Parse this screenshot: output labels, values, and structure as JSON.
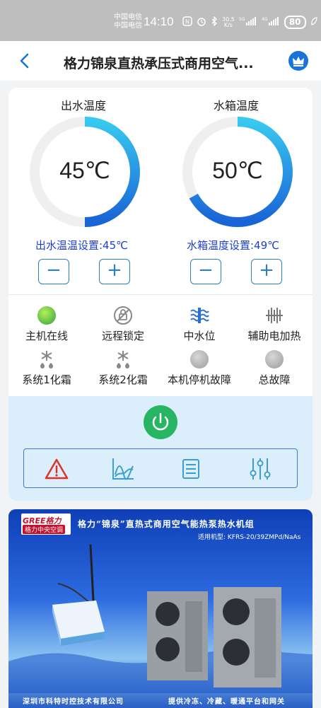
{
  "status_bar": {
    "carrier_1": "中国电信",
    "carrier_2": "中国电信",
    "time": "14:10",
    "net_speed": "30.5",
    "net_unit": "K/s",
    "battery": "80"
  },
  "header": {
    "title": "格力锦泉直热承压式商用空气..."
  },
  "gauges": [
    {
      "label": "出水温度",
      "value": "45℃",
      "fill_fraction": 0.5,
      "setpoint": "出水温温设置:45℃"
    },
    {
      "label": "水箱温度",
      "value": "50℃",
      "fill_fraction": 0.67,
      "setpoint": "水箱温度设置:49℃"
    }
  ],
  "stepper": {
    "minus": "−",
    "plus": "+"
  },
  "status_items": [
    {
      "label": "主机在线",
      "icon": "online-indicator-icon"
    },
    {
      "label": "远程锁定",
      "icon": "remote-lock-icon"
    },
    {
      "label": "中水位",
      "icon": "water-level-icon"
    },
    {
      "label": "辅助电加热",
      "icon": "electric-heat-icon"
    },
    {
      "label": "系统1化霜",
      "icon": "defrost-icon"
    },
    {
      "label": "系统2化霜",
      "icon": "defrost-icon"
    },
    {
      "label": "本机停机故障",
      "icon": "fault-dot-icon"
    },
    {
      "label": "总故障",
      "icon": "fault-dot-icon"
    }
  ],
  "toolbar": [
    "warning-icon",
    "chart-icon",
    "list-icon",
    "settings-sliders-icon"
  ],
  "banner": {
    "logo_top": "GREE格力",
    "logo_sub": "格力中央空调",
    "title": "格力“锦泉”直热式商用空气能热泵热水机组",
    "model": "适用机型: KFRS-20/39ZMPd/NaAs",
    "footer_left": "深圳市科特时控技术有限公司",
    "footer_right": "提供冷冻、冷藏、暖通平台和网关"
  },
  "colors": {
    "accent": "#1a73d9",
    "setpoint_text": "#1f3fcc",
    "power_button": "#27b463",
    "panel_bg": "#daeefb",
    "warning": "#e0302e"
  }
}
